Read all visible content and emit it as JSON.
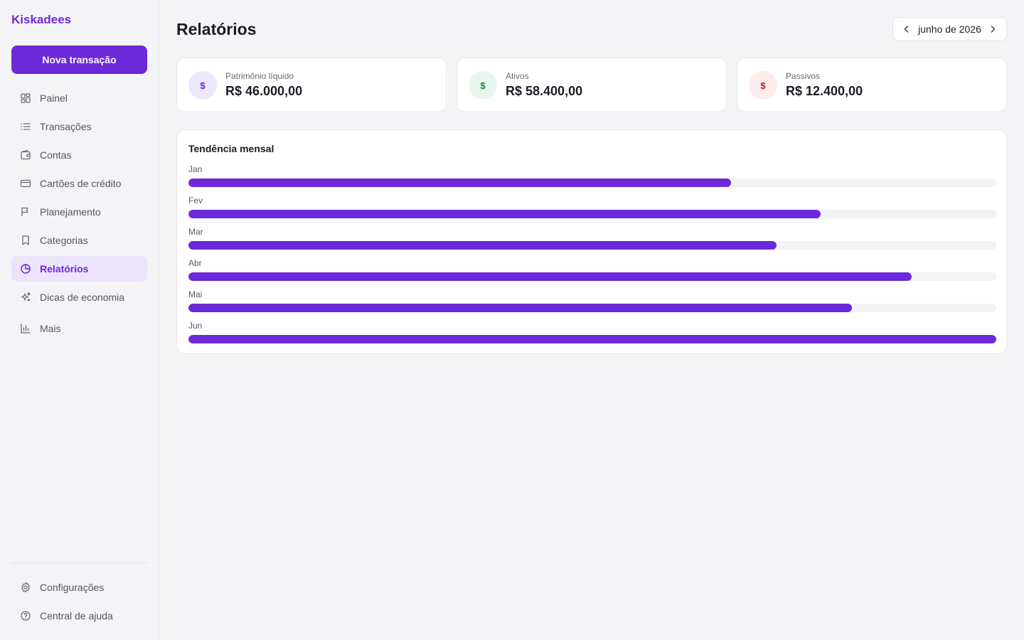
{
  "app": {
    "name": "Kiskadees"
  },
  "sidebar": {
    "new_transaction_label": "Nova transação",
    "items": [
      {
        "label": "Painel",
        "icon": "grid-icon",
        "active": false
      },
      {
        "label": "Transações",
        "icon": "list-icon",
        "active": false
      },
      {
        "label": "Contas",
        "icon": "wallet-icon",
        "active": false
      },
      {
        "label": "Cartões de crédito",
        "icon": "credit-card-icon",
        "active": false
      },
      {
        "label": "Planejamento",
        "icon": "flag-icon",
        "active": false
      },
      {
        "label": "Categorias",
        "icon": "bookmark-icon",
        "active": false
      },
      {
        "label": "Relatórios",
        "icon": "pie-chart-icon",
        "active": true
      },
      {
        "label": "Dicas de economia",
        "icon": "sparkles-icon",
        "active": false
      },
      {
        "label": "Mais",
        "icon": "bar-chart-icon",
        "active": false
      }
    ],
    "bottom_items": [
      {
        "label": "Configurações",
        "icon": "gear-icon"
      },
      {
        "label": "Central de ajuda",
        "icon": "help-circle-icon"
      }
    ]
  },
  "header": {
    "title": "Relatórios",
    "month": "junho de 2026"
  },
  "summary": [
    {
      "label": "Patrimônio líquido",
      "value": "R$ 46.000,00",
      "symbol": "$",
      "icon_bg": "#ede7fc",
      "icon_color": "#6d28d9"
    },
    {
      "label": "Ativos",
      "value": "R$ 58.400,00",
      "symbol": "$",
      "icon_bg": "#e8f7ee",
      "icon_color": "#15803d"
    },
    {
      "label": "Passivos",
      "value": "R$ 12.400,00",
      "symbol": "$",
      "icon_bg": "#fdecec",
      "icon_color": "#b91c1c"
    }
  ],
  "trend": {
    "title": "Tendência mensal",
    "months": [
      "Jan",
      "Fev",
      "Mar",
      "Abr",
      "Mai",
      "Jun"
    ],
    "fractions": [
      0.672,
      0.783,
      0.728,
      0.895,
      0.821,
      1.0
    ]
  },
  "colors": {
    "accent": "#6d28d9",
    "accent_soft": "#ebe4fb",
    "background": "#f4f4f6"
  }
}
